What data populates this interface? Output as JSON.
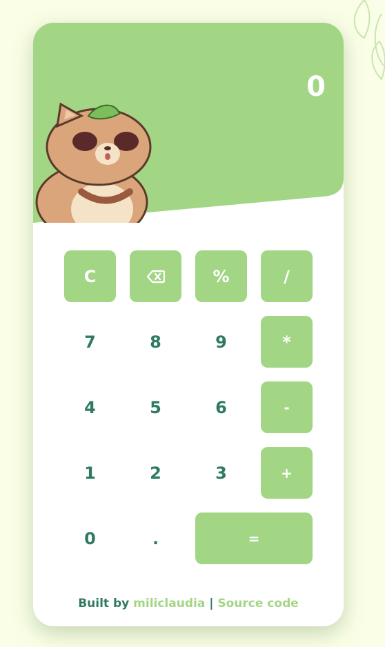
{
  "display": {
    "value": "0"
  },
  "keys": {
    "clear": "C",
    "percent": "%",
    "divide": "/",
    "seven": "7",
    "eight": "8",
    "nine": "9",
    "multiply": "*",
    "four": "4",
    "five": "5",
    "six": "6",
    "subtract": "-",
    "one": "1",
    "two": "2",
    "three": "3",
    "add": "+",
    "zero": "0",
    "decimal": ".",
    "equals": "="
  },
  "footer": {
    "prefix": "Built by",
    "author": "miliclaudia",
    "separator": "|",
    "source": "Source code"
  },
  "colors": {
    "accent": "#a2d584",
    "digit": "#2f7a63",
    "background": "#fafee6"
  },
  "icons": {
    "backspace": "backspace-icon"
  }
}
